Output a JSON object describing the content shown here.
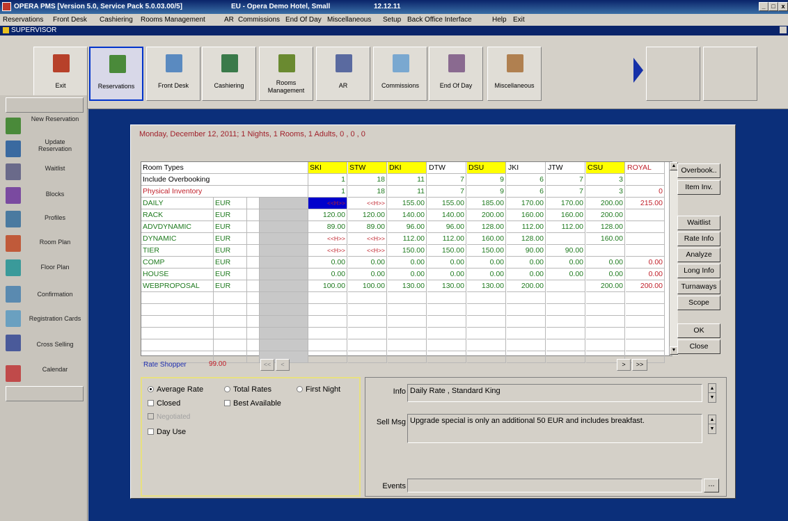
{
  "window": {
    "title": "OPERA PMS [Version 5.0, Service Pack 5.0.03.00/5]",
    "hotel": "EU - Opera Demo Hotel, Small",
    "date": "12.12.11",
    "controls": [
      "_",
      "□",
      "x"
    ]
  },
  "menu": [
    "Reservations",
    "Front Desk",
    "Cashiering",
    "Rooms Management",
    "AR",
    "Commissions",
    "End Of Day",
    "Miscellaneous",
    "Setup",
    "Back Office Interface",
    "Help",
    "Exit"
  ],
  "user": "SUPERVISOR",
  "toolbar": [
    {
      "label": "Exit",
      "icon": "exit-door-icon"
    },
    {
      "label": "Reservations",
      "icon": "reservations-icon"
    },
    {
      "label": "Front Desk",
      "icon": "front-desk-icon"
    },
    {
      "label": "Cashiering",
      "icon": "cashiering-icon"
    },
    {
      "label": "Rooms Management",
      "icon": "rooms-management-icon"
    },
    {
      "label": "AR",
      "icon": "ar-icon"
    },
    {
      "label": "Commissions",
      "icon": "commissions-icon"
    },
    {
      "label": "End Of Day",
      "icon": "end-of-day-icon"
    },
    {
      "label": "Miscellaneous",
      "icon": "miscellaneous-icon"
    }
  ],
  "sidebar": [
    {
      "label": "New Reservation",
      "icon": "new-reservation-icon"
    },
    {
      "label": "Update Reservation",
      "icon": "update-reservation-icon"
    },
    {
      "label": "Waitlist",
      "icon": "waitlist-icon"
    },
    {
      "label": "Blocks",
      "icon": "blocks-icon"
    },
    {
      "label": "Profiles",
      "icon": "profiles-icon"
    },
    {
      "label": "Room Plan",
      "icon": "room-plan-icon"
    },
    {
      "label": "Floor Plan",
      "icon": "floor-plan-icon"
    },
    {
      "label": "Confirmation",
      "icon": "confirmation-icon"
    },
    {
      "label": "Registration Cards",
      "icon": "registration-cards-icon"
    },
    {
      "label": "Cross Selling",
      "icon": "cross-selling-icon"
    },
    {
      "label": "Calendar",
      "icon": "calendar-icon"
    }
  ],
  "rate_query": {
    "header": "Monday, December  12, 2011; 1 Nights, 1 Rooms, 1 Adults, 0 , 0 , 0",
    "columns": [
      "SKI",
      "STW",
      "DKI",
      "DTW",
      "DSU",
      "JKI",
      "JTW",
      "CSU",
      "ROYAL"
    ],
    "highlight_columns": [
      "SKI",
      "STW",
      "DKI",
      "DSU",
      "CSU"
    ],
    "room_types_label": "Room Types",
    "overbooking": {
      "label": "Include Overbooking",
      "values": [
        "1",
        "18",
        "11",
        "7",
        "9",
        "6",
        "7",
        "3",
        ""
      ]
    },
    "inventory": {
      "label": "Physical Inventory",
      "values": [
        "1",
        "18",
        "11",
        "7",
        "9",
        "6",
        "7",
        "3",
        "0"
      ]
    },
    "rows": [
      {
        "code": "DAILY",
        "cur": "EUR",
        "values": [
          "<<H>>",
          "<<H>>",
          "155.00",
          "155.00",
          "185.00",
          "170.00",
          "170.00",
          "200.00",
          "215.00"
        ]
      },
      {
        "code": "RACK",
        "cur": "EUR",
        "values": [
          "120.00",
          "120.00",
          "140.00",
          "140.00",
          "200.00",
          "160.00",
          "160.00",
          "200.00",
          ""
        ]
      },
      {
        "code": "ADVDYNAMIC",
        "cur": "EUR",
        "values": [
          "89.00",
          "89.00",
          "96.00",
          "96.00",
          "128.00",
          "112.00",
          "112.00",
          "128.00",
          ""
        ]
      },
      {
        "code": "DYNAMIC",
        "cur": "EUR",
        "values": [
          "<<H>>",
          "<<H>>",
          "112.00",
          "112.00",
          "160.00",
          "128.00",
          "",
          "160.00",
          ""
        ]
      },
      {
        "code": "TIER",
        "cur": "EUR",
        "values": [
          "<<H>>",
          "<<H>>",
          "150.00",
          "150.00",
          "150.00",
          "90.00",
          "90.00",
          "",
          ""
        ]
      },
      {
        "code": "COMP",
        "cur": "EUR",
        "values": [
          "0.00",
          "0.00",
          "0.00",
          "0.00",
          "0.00",
          "0.00",
          "0.00",
          "0.00",
          "0.00"
        ]
      },
      {
        "code": "HOUSE",
        "cur": "EUR",
        "values": [
          "0.00",
          "0.00",
          "0.00",
          "0.00",
          "0.00",
          "0.00",
          "0.00",
          "0.00",
          "0.00"
        ]
      },
      {
        "code": "WEBPROPOSAL",
        "cur": "EUR",
        "values": [
          "100.00",
          "100.00",
          "130.00",
          "130.00",
          "130.00",
          "200.00",
          "",
          "200.00",
          "200.00"
        ]
      }
    ],
    "rate_shopper": {
      "label": "Rate Shopper",
      "value": "99.00"
    },
    "nav": {
      "first": "<<",
      "prev": "<",
      "next": ">",
      "last": ">>"
    }
  },
  "side_buttons": [
    "Overbook..",
    "Item Inv.",
    "Waitlist",
    "Rate Info",
    "Analyze",
    "Long Info",
    "Turnaways",
    "Scope",
    "OK",
    "Close"
  ],
  "options": {
    "radios": [
      {
        "label": "Average Rate",
        "checked": true
      },
      {
        "label": "Total Rates",
        "checked": false
      },
      {
        "label": "First Night",
        "checked": false
      }
    ],
    "checks": [
      {
        "label": "Closed",
        "disabled": false
      },
      {
        "label": "Best Available",
        "disabled": false
      },
      {
        "label": "Negotiated",
        "disabled": true
      },
      {
        "label": "Day Use",
        "disabled": false
      }
    ]
  },
  "info": {
    "info_label": "Info",
    "info_text": "Daily Rate , Standard King",
    "sell_label": "Sell Msg",
    "sell_text": "Upgrade special is only an additional 50 EUR and includes breakfast.",
    "events_label": "Events",
    "events_button": "..."
  },
  "colors": {
    "highlight": "#ffff00",
    "green_text": "#1e7a1e",
    "red_text": "#c0202a",
    "selected_cell": "#0000cc"
  }
}
